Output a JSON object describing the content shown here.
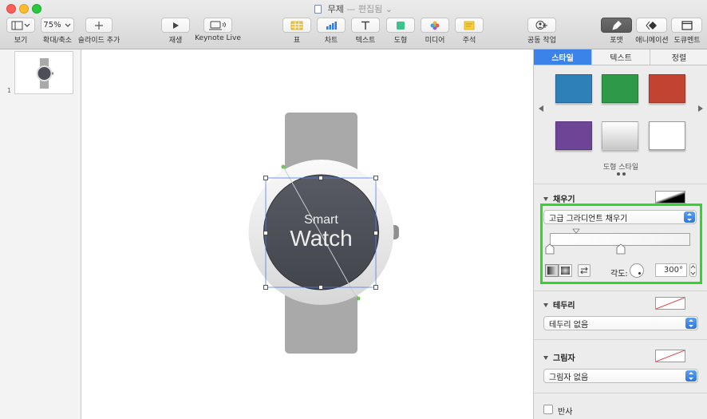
{
  "window": {
    "title": "무제",
    "separator": "—",
    "status": "편집됨",
    "status_chevron": "⌄"
  },
  "toolbar": {
    "view_label": "보기",
    "zoom_value": "75%",
    "zoom_label": "확대/축소",
    "add_slide_label": "슬라이드 추가",
    "play_label": "재생",
    "keynote_live_label": "Keynote Live",
    "table_label": "표",
    "chart_label": "차트",
    "text_label": "텍스트",
    "shape_label": "도형",
    "media_label": "미디어",
    "comment_label": "주석",
    "collaborate_label": "공동 작업",
    "format_label": "포맷",
    "animate_label": "애니메이션",
    "document_label": "도큐멘트"
  },
  "navigator": {
    "slide_number": "1"
  },
  "canvas": {
    "watch_text_line1": "Smart",
    "watch_text_line2": "Watch"
  },
  "inspector": {
    "tabs": [
      "스타일",
      "텍스트",
      "정렬"
    ],
    "active_tab": 0,
    "style_swatches": [
      {
        "name": "blue",
        "color": "#2e80b8"
      },
      {
        "name": "green",
        "color": "#2e9a48"
      },
      {
        "name": "red",
        "color": "#c24430"
      },
      {
        "name": "purple",
        "color": "#6e4496"
      },
      {
        "name": "gradient-gray",
        "color": "#d9d9d9"
      },
      {
        "name": "white",
        "color": "#ffffff"
      }
    ],
    "shape_styles_label": "도형 스타일",
    "fill": {
      "label": "채우기",
      "type_value": "고급 그라디언트 채우기",
      "angle_label": "각도:",
      "angle_value": "300°"
    },
    "border": {
      "label": "테두리",
      "value": "테두리 없음"
    },
    "shadow": {
      "label": "그림자",
      "value": "그림자 없음"
    },
    "reflection": {
      "label": "반사"
    }
  },
  "colors": {
    "accent": "#3b83e8",
    "highlight": "#32d62a",
    "watch_face": "#4d4f58",
    "watch_band": "#a9a9a9"
  }
}
